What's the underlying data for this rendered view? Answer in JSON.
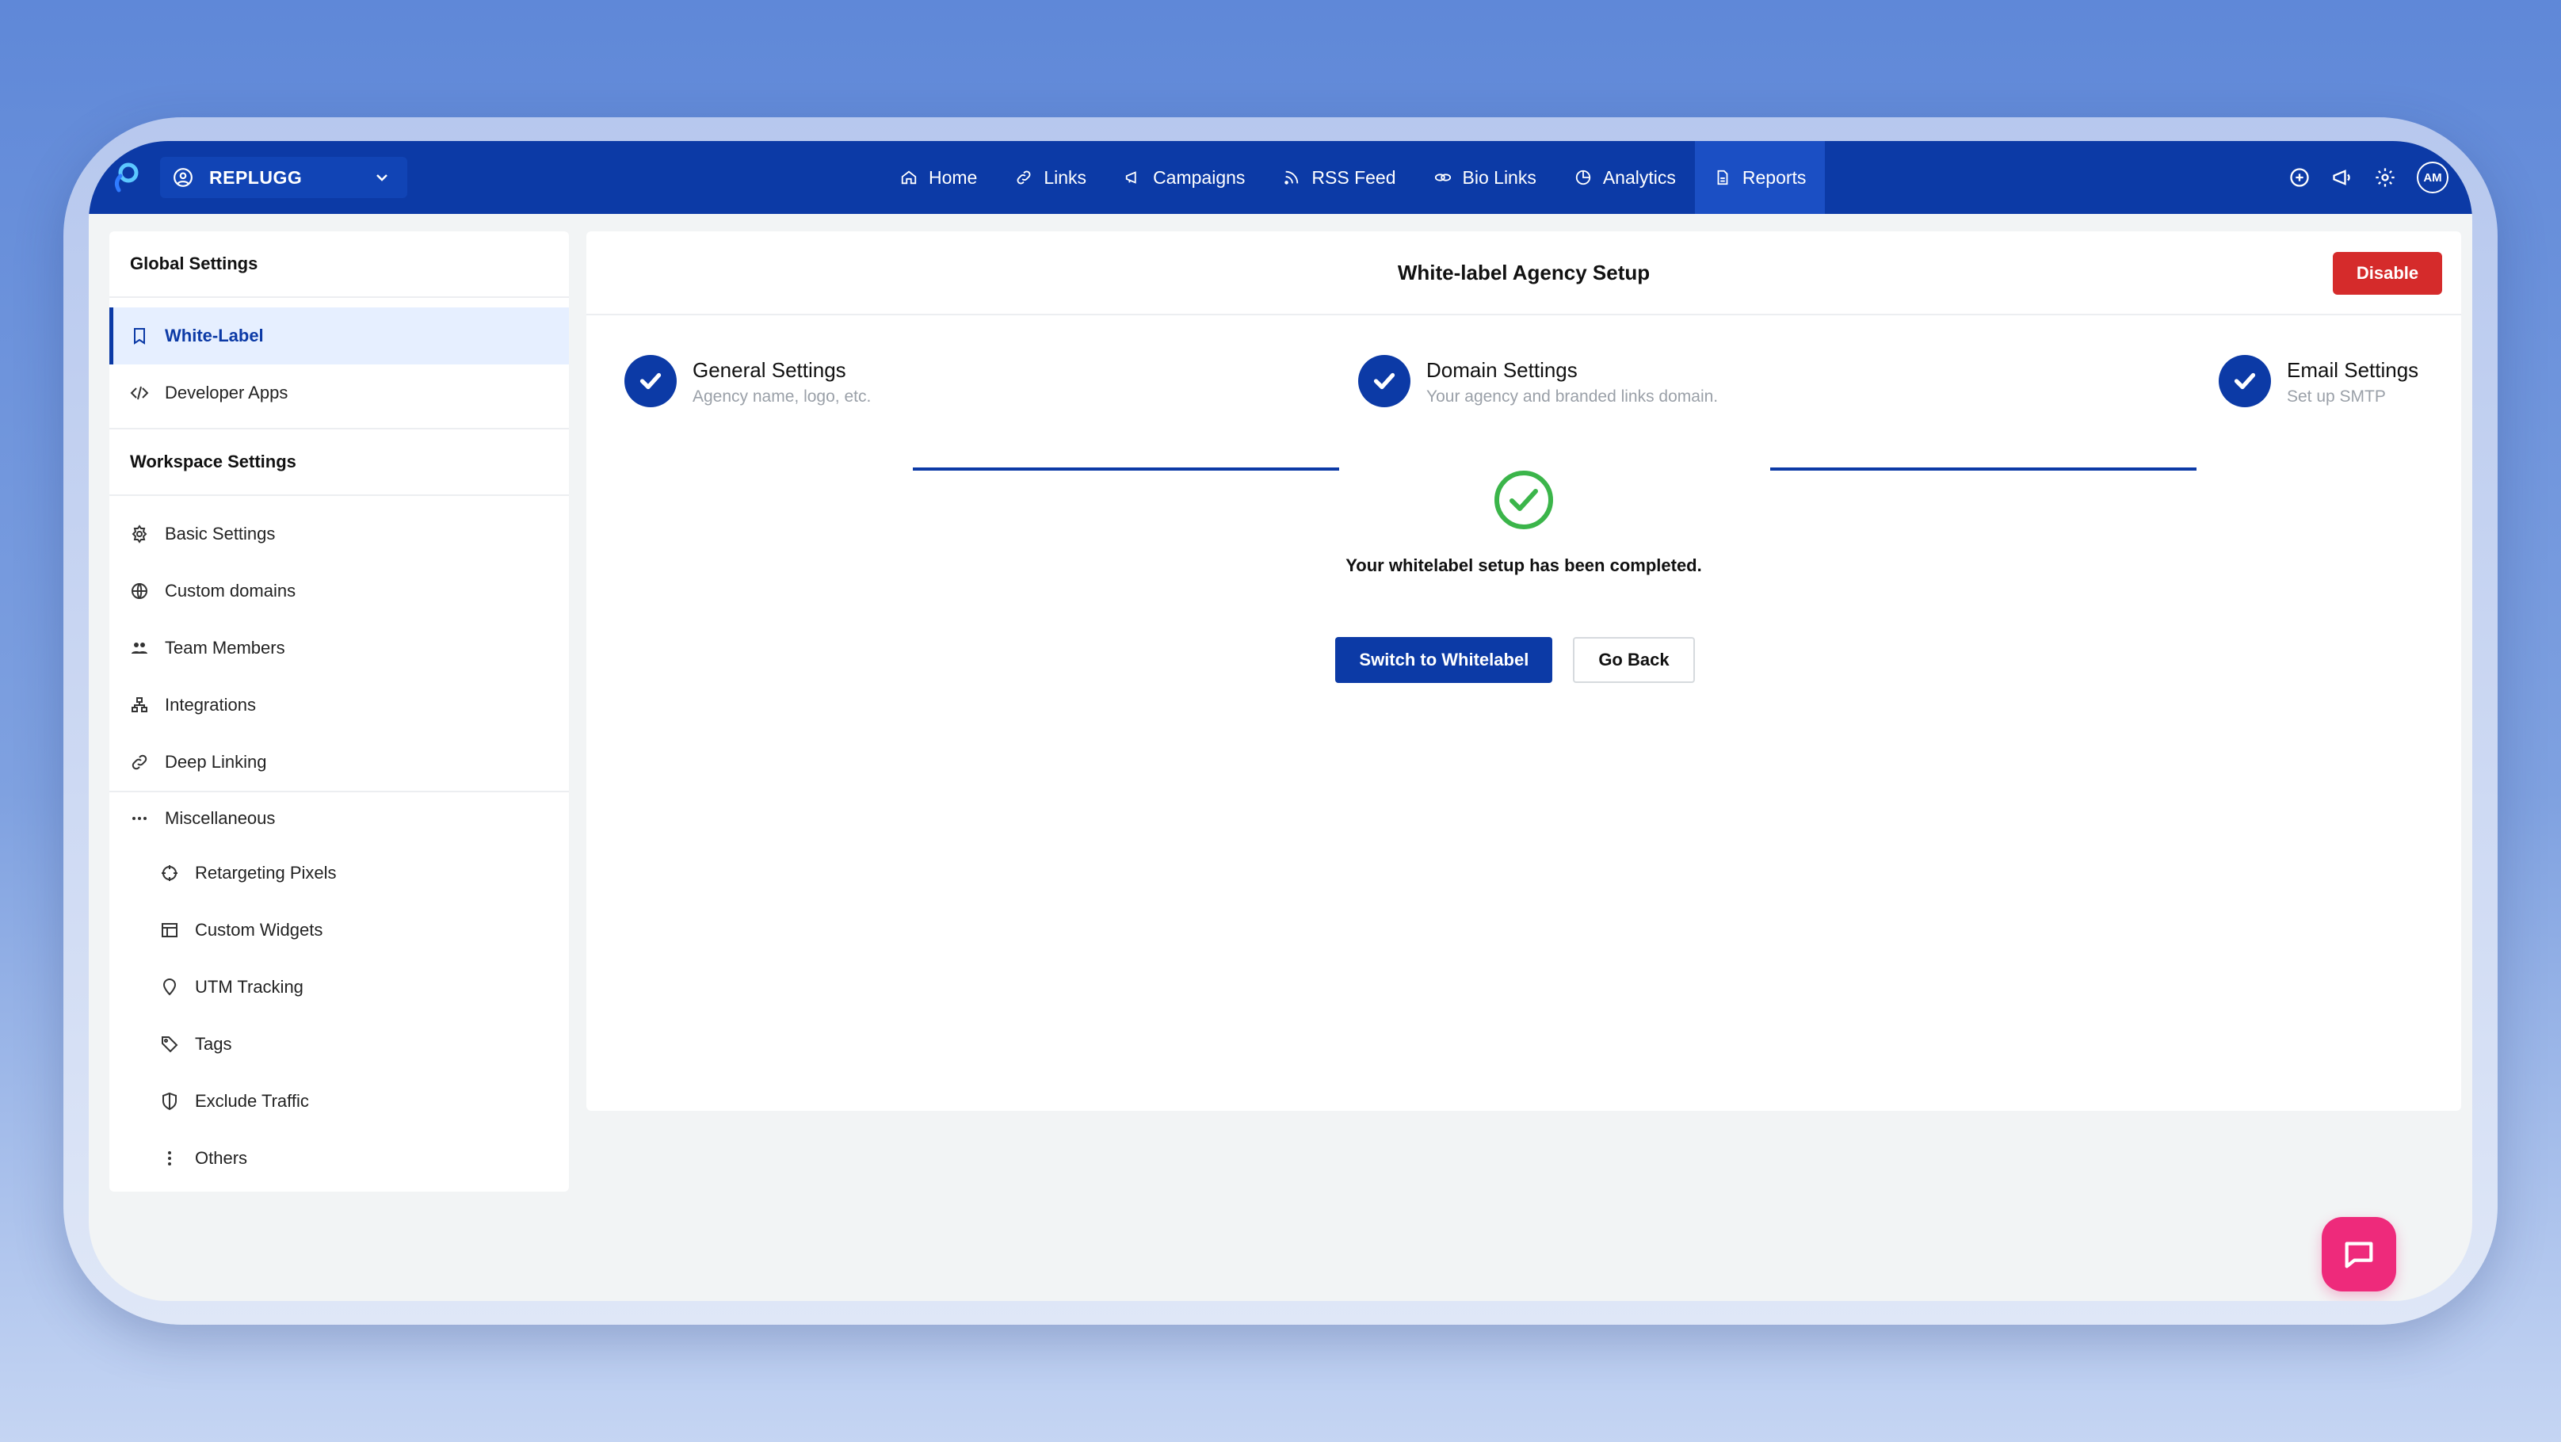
{
  "workspace": {
    "name": "REPLUGG"
  },
  "nav": {
    "items": [
      {
        "label": "Home",
        "icon": "home-icon"
      },
      {
        "label": "Links",
        "icon": "link-icon"
      },
      {
        "label": "Campaigns",
        "icon": "megaphone-icon"
      },
      {
        "label": "RSS Feed",
        "icon": "rss-icon"
      },
      {
        "label": "Bio Links",
        "icon": "bio-link-icon"
      },
      {
        "label": "Analytics",
        "icon": "analytics-icon"
      },
      {
        "label": "Reports",
        "icon": "report-icon",
        "active": true
      }
    ],
    "avatar_initials": "AM"
  },
  "sidebar": {
    "global_heading": "Global Settings",
    "global_items": [
      {
        "label": "White-Label",
        "icon": "bookmark-icon",
        "active": true
      },
      {
        "label": "Developer Apps",
        "icon": "code-icon"
      }
    ],
    "workspace_heading": "Workspace Settings",
    "workspace_items": [
      {
        "label": "Basic Settings",
        "icon": "gear-icon"
      },
      {
        "label": "Custom domains",
        "icon": "globe-icon"
      },
      {
        "label": "Team Members",
        "icon": "team-icon"
      },
      {
        "label": "Integrations",
        "icon": "integrations-icon"
      },
      {
        "label": "Deep Linking",
        "icon": "link-icon"
      }
    ],
    "misc_label": "Miscellaneous",
    "misc_items": [
      {
        "label": "Retargeting Pixels",
        "icon": "crosshair-icon"
      },
      {
        "label": "Custom Widgets",
        "icon": "widget-icon"
      },
      {
        "label": "UTM Tracking",
        "icon": "pin-icon"
      },
      {
        "label": "Tags",
        "icon": "tag-icon"
      },
      {
        "label": "Exclude Traffic",
        "icon": "shield-icon"
      },
      {
        "label": "Others",
        "icon": "more-vertical-icon"
      }
    ]
  },
  "main": {
    "title": "White-label Agency Setup",
    "disable_label": "Disable",
    "steps": [
      {
        "title": "General Settings",
        "subtitle": "Agency name, logo, etc.",
        "completed": true
      },
      {
        "title": "Domain Settings",
        "subtitle": "Your agency and branded links domain.",
        "completed": true
      },
      {
        "title": "Email Settings",
        "subtitle": "Set up SMTP",
        "completed": true
      }
    ],
    "success_message": "Your whitelabel setup has been completed.",
    "switch_label": "Switch to Whitelabel",
    "back_label": "Go Back"
  },
  "colors": {
    "primary": "#0c3aa6",
    "danger": "#d52b2b",
    "success": "#3bb54a",
    "chat": "#ee2a7b"
  }
}
